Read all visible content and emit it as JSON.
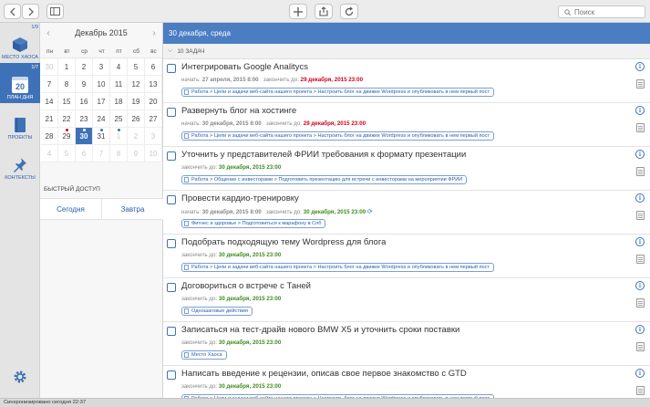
{
  "toolbar": {
    "search_placeholder": "Поиск"
  },
  "sidebar": {
    "items": [
      {
        "label": "МЕСТО ХАОСА",
        "count": "1/9",
        "icon": "box-icon"
      },
      {
        "label": "ПЛАН ДНЯ",
        "count": "1/7",
        "icon": "calendar-day-icon",
        "day": "20"
      },
      {
        "label": "ПРОЕКТЫ",
        "icon": "book-icon"
      },
      {
        "label": "КОНТЕКСТЫ",
        "icon": "pin-icon"
      }
    ]
  },
  "calendar": {
    "month": "Декабрь 2015",
    "weekdays": [
      "пн",
      "вт",
      "ср",
      "чт",
      "пт",
      "сб",
      "вс"
    ],
    "weeks": [
      [
        {
          "d": "30",
          "o": true
        },
        {
          "d": "1"
        },
        {
          "d": "2"
        },
        {
          "d": "3"
        },
        {
          "d": "4"
        },
        {
          "d": "5"
        },
        {
          "d": "6"
        }
      ],
      [
        {
          "d": "7"
        },
        {
          "d": "8"
        },
        {
          "d": "9"
        },
        {
          "d": "10"
        },
        {
          "d": "11"
        },
        {
          "d": "12"
        },
        {
          "d": "13"
        }
      ],
      [
        {
          "d": "14"
        },
        {
          "d": "15"
        },
        {
          "d": "16"
        },
        {
          "d": "17"
        },
        {
          "d": "18"
        },
        {
          "d": "19"
        },
        {
          "d": "20"
        }
      ],
      [
        {
          "d": "21"
        },
        {
          "d": "22"
        },
        {
          "d": "23"
        },
        {
          "d": "24"
        },
        {
          "d": "25"
        },
        {
          "d": "26"
        },
        {
          "d": "27"
        }
      ],
      [
        {
          "d": "28"
        },
        {
          "d": "29",
          "dot": "red"
        },
        {
          "d": "30",
          "today": true,
          "dot": "white"
        },
        {
          "d": "31",
          "dot": "blue"
        },
        {
          "d": "1",
          "o": true,
          "dot": "blue"
        },
        {
          "d": "2",
          "o": true
        },
        {
          "d": "3",
          "o": true
        }
      ],
      [
        {
          "d": "4",
          "o": true
        },
        {
          "d": "5",
          "o": true
        },
        {
          "d": "6",
          "o": true
        },
        {
          "d": "7",
          "o": true
        },
        {
          "d": "8",
          "o": true
        },
        {
          "d": "9",
          "o": true
        },
        {
          "d": "10",
          "o": true
        }
      ]
    ]
  },
  "quick_access": {
    "title": "БЫСТРЫЙ ДОСТУП",
    "today": "Сегодня",
    "tomorrow": "Завтра"
  },
  "main": {
    "date_header": "30 декабря, среда",
    "task_count": "10 ЗАДАЧ"
  },
  "tasks": [
    {
      "title": "Интегрировать Google Analitycs",
      "start_label": "начать:",
      "start": "27 апреля, 2015 8:00",
      "end_label": "закончить до:",
      "end": "29 декабря, 2015 23:00",
      "end_status": "overdue",
      "tag": "Работа > Цели и задачи веб-сайта нашего проекта > Настроить блог на движке Wordpress и опубликовать в нем первый пост"
    },
    {
      "title": "Развернуть блог на хостинге",
      "start_label": "начать:",
      "start": "30 декабря, 2015 8:00",
      "end_label": "закончить до:",
      "end": "29 декабря, 2015 23:00",
      "end_status": "overdue",
      "tag": "Работа > Цели и задачи веб-сайта нашего проекта > Настроить блог на движке Wordpress и опубликовать в нем первый пост"
    },
    {
      "title": "Уточнить у представителей ФРИИ требования к формату презентации",
      "end_label": "закончить до:",
      "end": "30 декабря, 2015 23:00",
      "end_status": "due",
      "tag": "Работа > Общение с инвесторами > Подготовить презентацию для встречи с инвесторами на мероприятии ФРИИ"
    },
    {
      "title": "Провести кардио-тренировку",
      "start_label": "начать:",
      "start": "30 декабря, 2015 8:00",
      "end_label": "закончить до:",
      "end": "30 декабря, 2015 23:00",
      "end_status": "due",
      "repeat": "repeat-icon",
      "tag": "Фитнес и здоровье > Подготовиться к марафону в Спб"
    },
    {
      "title": "Подобрать подходящую тему Wordpress для блога",
      "end_label": "закончить до:",
      "end": "30 декабря, 2015 23:00",
      "end_status": "due",
      "tag": "Работа > Цели и задачи веб-сайта нашего проекта > Настроить блог на движке Wordpress и опубликовать в нем первый пост"
    },
    {
      "title": "Договориться о встрече с Таней",
      "end_label": "закончить до:",
      "end": "30 декабря, 2015 23:00",
      "end_status": "due",
      "tag": "Одношаговые действия"
    },
    {
      "title": "Записаться на тест-драйв нового BMW X5 и уточнить сроки поставки",
      "end_label": "закончить до:",
      "end": "30 декабря, 2015 23:00",
      "end_status": "due",
      "tag": "Место Хаоса"
    },
    {
      "title": "Написать введение к рецензии, описав свое первое знакомство с GTD",
      "end_label": "закончить до:",
      "end": "30 декабря, 2015 23:00",
      "end_status": "due",
      "tag": "Работа > Цели и задачи веб-сайта нашего проекта > Настроить блог на движке Wordpress и опубликовать в нем первый пост"
    }
  ],
  "status": {
    "sync": "Синхронизировано сегодня 22:37"
  },
  "colors": {
    "accent": "#3e72b8",
    "header": "#4a7dc1",
    "overdue": "#d0021b",
    "due": "#3f8c1f"
  }
}
